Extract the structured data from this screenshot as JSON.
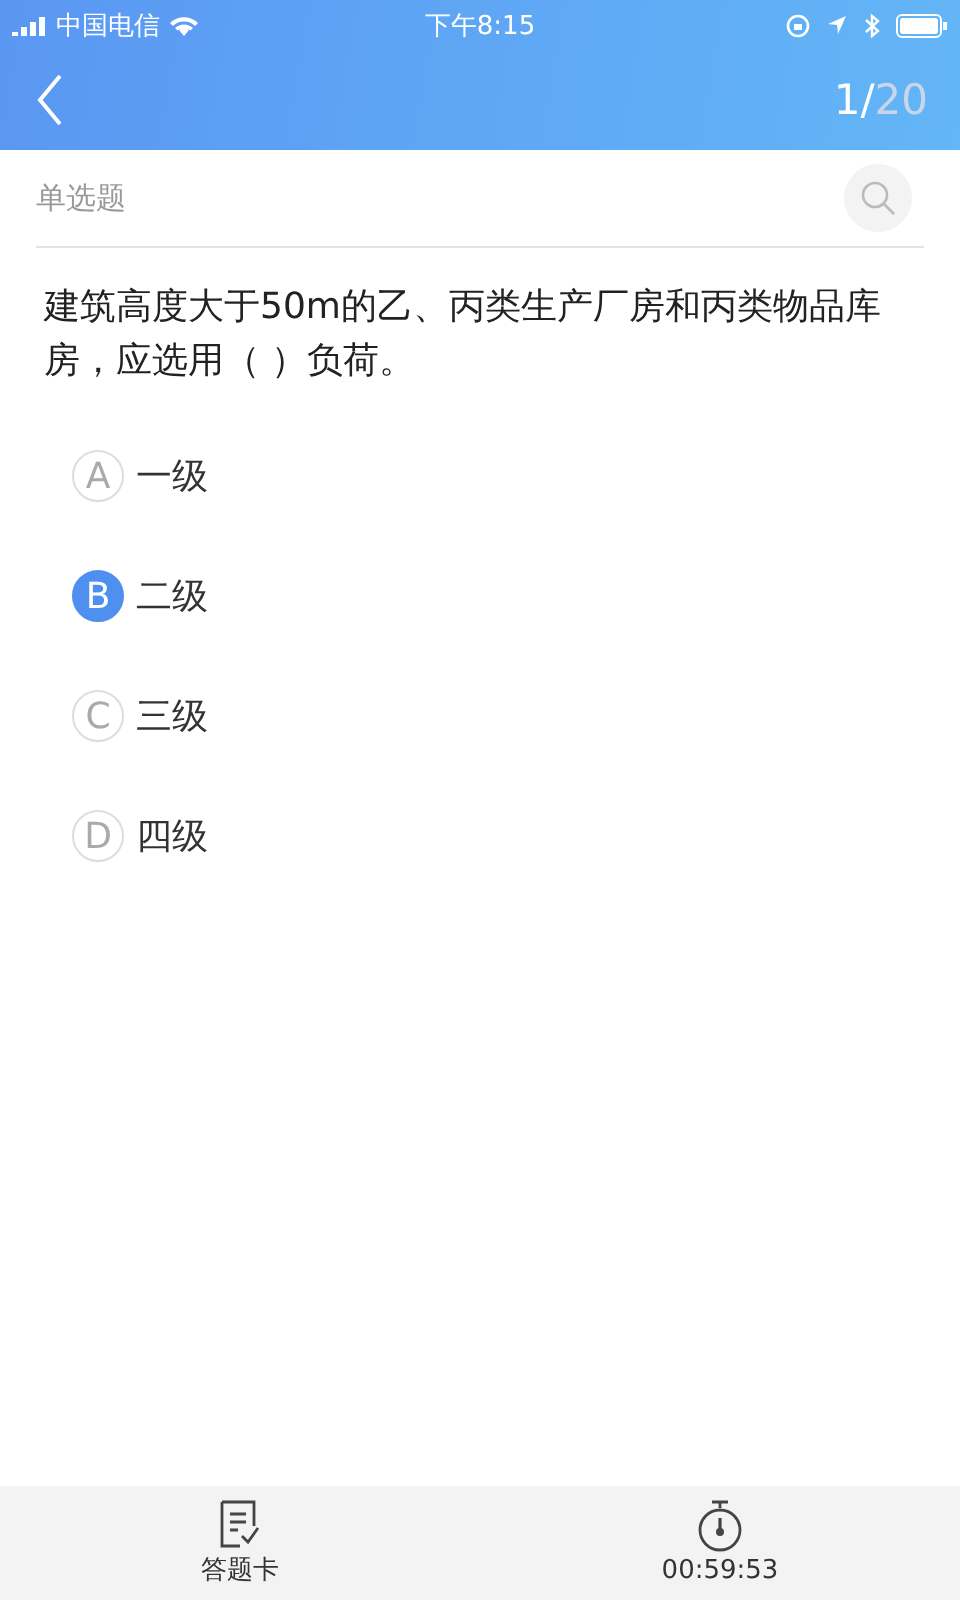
{
  "status_bar": {
    "carrier": "中国电信",
    "time": "下午8:15"
  },
  "header": {
    "current": "1/",
    "total": "20"
  },
  "question_type": "单选题",
  "question": "建筑高度大于50m的乙、丙类生产厂房和丙类物品库房，应选用（ ）负荷。",
  "options": [
    {
      "letter": "A",
      "text": "一级",
      "selected": false
    },
    {
      "letter": "B",
      "text": "二级",
      "selected": true
    },
    {
      "letter": "C",
      "text": "三级",
      "selected": false
    },
    {
      "letter": "D",
      "text": "四级",
      "selected": false
    }
  ],
  "bottom_bar": {
    "answer_card": "答题卡",
    "timer": "00:59:53"
  }
}
